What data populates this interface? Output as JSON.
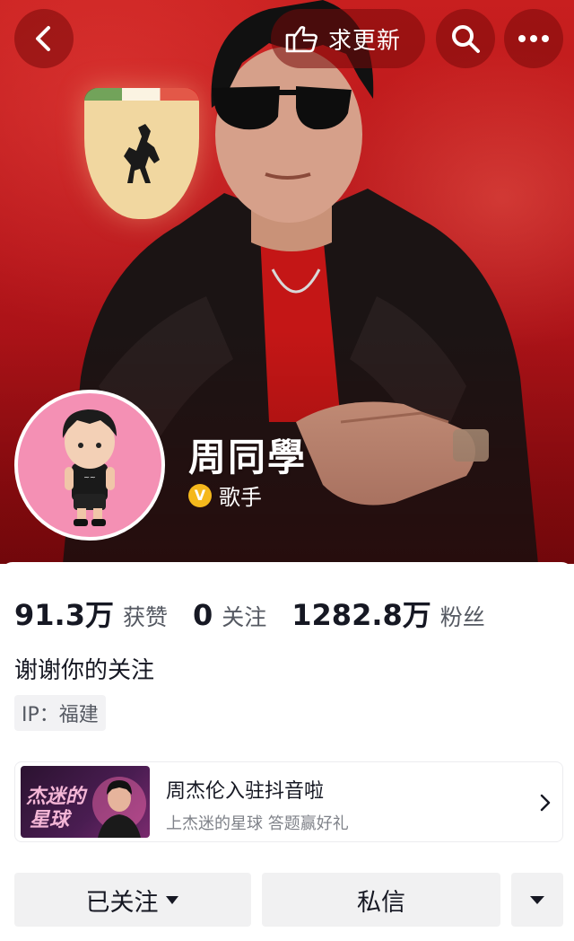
{
  "header": {
    "update_label": "求更新"
  },
  "profile": {
    "name": "周同學",
    "verify_badge": "V",
    "verify_title": "歌手",
    "bio": "谢谢你的关注",
    "ip_label": "IP：福建"
  },
  "stats": [
    {
      "value": "91.3万",
      "label": "获赞"
    },
    {
      "value": "0",
      "label": "关注"
    },
    {
      "value": "1282.8万",
      "label": "粉丝"
    }
  ],
  "promo": {
    "thumb_line1": "杰迷的",
    "thumb_line2": "星球",
    "title": "周杰伦入驻抖音啦",
    "subtitle": "上杰迷的星球 答题赢好礼"
  },
  "actions": {
    "follow_label": "已关注",
    "message_label": "私信"
  },
  "icons": [
    "back-icon",
    "hand-pointer-icon",
    "search-icon",
    "more-icon",
    "verified-icon",
    "chevron-right-icon",
    "caret-down-icon"
  ],
  "colors": {
    "banner_red": "#c81f1f",
    "verify_gold": "#f5b81c",
    "button_gray": "#f1f1f2",
    "avatar_pink": "#f490b4"
  }
}
